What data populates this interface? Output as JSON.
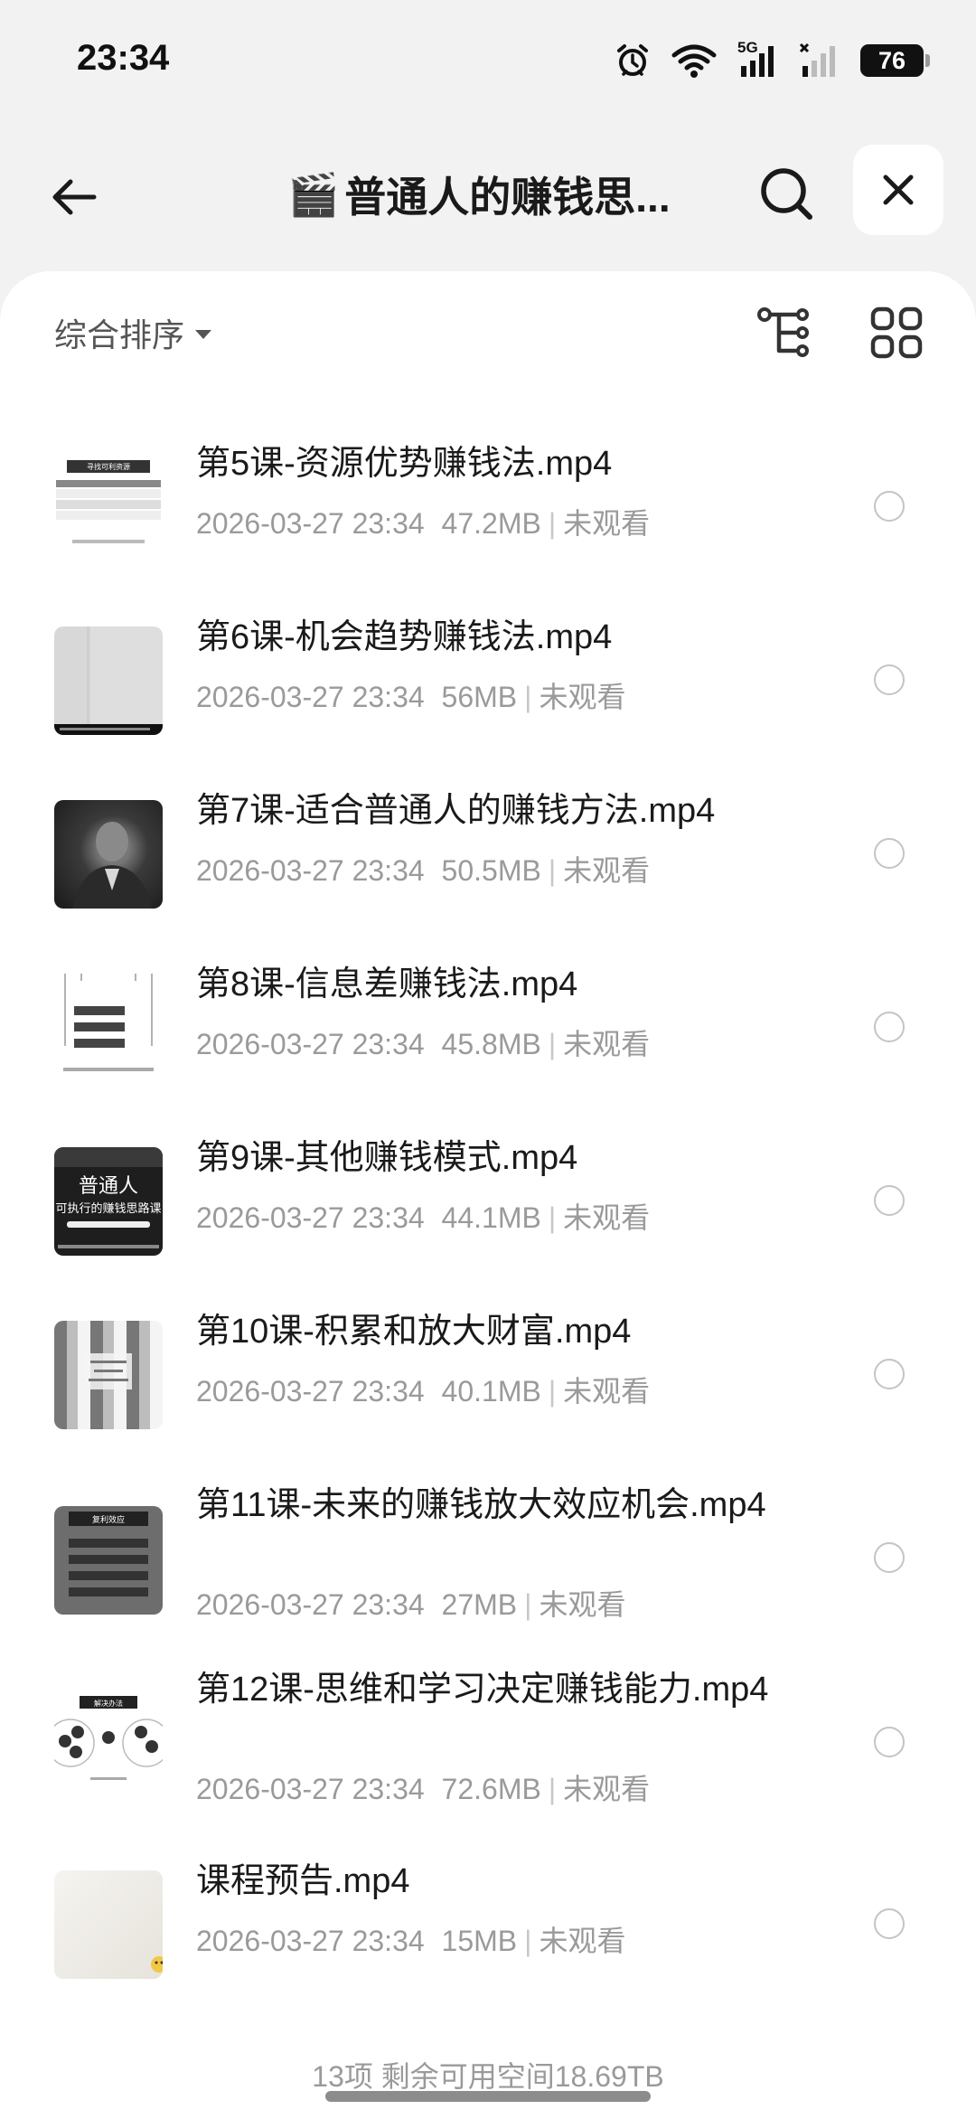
{
  "status_bar": {
    "time": "23:34",
    "network": "5G",
    "battery": "76"
  },
  "header": {
    "title_emoji": "🎬",
    "title": "普通人的赚钱思...",
    "back_icon": "arrow-left-icon",
    "search_icon": "search-icon",
    "close_icon": "close-icon"
  },
  "toolbar": {
    "sort_label": "综合排序",
    "tree_icon": "tree-view-icon",
    "grid_icon": "grid-view-icon"
  },
  "files": [
    {
      "name": "第5课-资源优势赚钱法.mp4",
      "date": "2026-03-27 23:34",
      "size": "47.2MB",
      "status": "未观看",
      "thumb_text": "寻找可利资源"
    },
    {
      "name": "第6课-机会趋势赚钱法.mp4",
      "date": "2026-03-27 23:34",
      "size": "56MB",
      "status": "未观看"
    },
    {
      "name": "第7课-适合普通人的赚钱方法.mp4",
      "date": "2026-03-27 23:34",
      "size": "50.5MB",
      "status": "未观看"
    },
    {
      "name": "第8课-信息差赚钱法.mp4",
      "date": "2026-03-27 23:34",
      "size": "45.8MB",
      "status": "未观看"
    },
    {
      "name": "第9课-其他赚钱模式.mp4",
      "date": "2026-03-27 23:34",
      "size": "44.1MB",
      "status": "未观看",
      "thumb_title": "普通人",
      "thumb_sub": "可执行的赚钱思路课"
    },
    {
      "name": "第10课-积累和放大财富.mp4",
      "date": "2026-03-27 23:34",
      "size": "40.1MB",
      "status": "未观看"
    },
    {
      "name": "第11课-未来的赚钱放大效应机会.mp4",
      "date": "2026-03-27 23:34",
      "size": "27MB",
      "status": "未观看",
      "thumb_text": "复利效应"
    },
    {
      "name": "第12课-思维和学习决定赚钱能力.mp4",
      "date": "2026-03-27 23:34",
      "size": "72.6MB",
      "status": "未观看",
      "thumb_text": "解决办法"
    },
    {
      "name": "课程预告.mp4",
      "date": "2026-03-27 23:34",
      "size": "15MB",
      "status": "未观看"
    }
  ],
  "footer": {
    "summary": "13项 剩余可用空间18.69TB"
  }
}
